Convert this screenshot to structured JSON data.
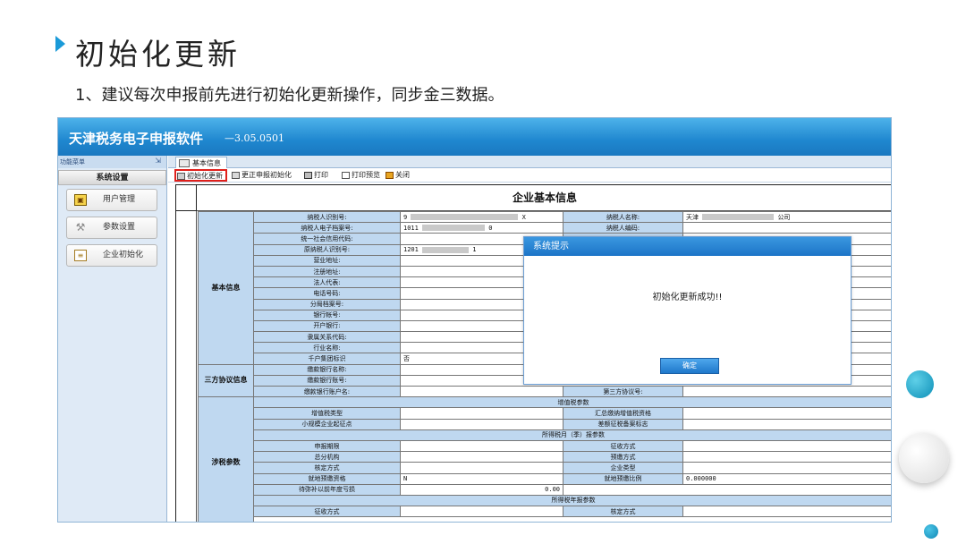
{
  "slide": {
    "heading": "初始化更新",
    "subtitle": "1、建议每次申报前先进行初始化更新操作，同步金三数据。"
  },
  "app": {
    "title": "天津税务电子申报软件",
    "version": "—3.05.0501"
  },
  "sidebar": {
    "header": "功能菜单",
    "pin": "⇲",
    "section": "系统设置",
    "items": [
      {
        "label": "用户管理",
        "icon": "user-icon"
      },
      {
        "label": "参数设置",
        "icon": "wrench-icon"
      },
      {
        "label": "企业初始化",
        "icon": "document-icon"
      }
    ]
  },
  "tab": {
    "label": "基本信息"
  },
  "toolbar": {
    "init": "初始化更新",
    "fix": "更正申报初始化",
    "print": "打印",
    "preview": "打印预览",
    "close": "关闭"
  },
  "form": {
    "title": "企业基本信息",
    "groups": {
      "basic": "基本信息",
      "tripartite": "三方协议信息",
      "tax": "涉税参数"
    },
    "basic_rows": [
      {
        "label": "纳税人识别号:",
        "value": "9",
        "value_tail": "X",
        "label2": "纳税人名称:",
        "value2": "天津",
        "value2_tail": "公司"
      },
      {
        "label": "纳税人电子档案号:",
        "value": "1011",
        "value_tail": "0",
        "label2": "纳税人编码:",
        "value2": ""
      },
      {
        "label": "统一社会信用代码:",
        "value": "",
        "label2": "",
        "value2": ""
      },
      {
        "label": "原纳税人识别号:",
        "value": "1201",
        "value_tail": "1",
        "label2": "",
        "value2": ""
      },
      {
        "label": "营业地址:",
        "value": ""
      },
      {
        "label": "注册地址:",
        "value": ""
      },
      {
        "label": "法人代表:",
        "value": ""
      },
      {
        "label": "电话号码:",
        "value": ""
      },
      {
        "label": "分局档案号:",
        "value": ""
      },
      {
        "label": "银行帐号:",
        "value": ""
      },
      {
        "label": "开户银行:",
        "value": ""
      },
      {
        "label": "隶属关系代码:",
        "value": ""
      },
      {
        "label": "行业名称:",
        "value": ""
      },
      {
        "label": "千户集团标识",
        "value": "否"
      }
    ],
    "tripartite_rows": [
      {
        "label": "缴款银行名称:",
        "value": ""
      },
      {
        "label": "缴款银行账号:",
        "value": ""
      },
      {
        "label": "缴款银行账户名:",
        "value": "",
        "label2": "第三方协议号:",
        "value2": ""
      }
    ],
    "tax_rows": {
      "vat_section": "增值税参数",
      "vat_type": "增值税类型",
      "vat_summary": "汇总缴纳增值税资格",
      "small_scale": "小规模企业起征点",
      "diff_levy": "差额征税备案标志",
      "income_section": "所得税月（季）报参数",
      "declare_period": "申报期限",
      "levy_method": "征收方式",
      "hq_branch": "总分机构",
      "prepay_method": "预缴方式",
      "assess_method": "核定方式",
      "enterprise_type": "企业类型",
      "local_prepay": "就地预缴资格",
      "local_prepay_value": "N",
      "local_prepay_ratio": "就地预缴比例",
      "local_prepay_ratio_value": "0.000000",
      "loss_carryover": "待弥补以前年度亏损",
      "loss_carryover_value": "0.00",
      "annual_section": "所得税年报参数",
      "annual_levy": "征收方式",
      "annual_assess": "核定方式"
    }
  },
  "dialog": {
    "title": "系统提示",
    "message": "初始化更新成功!!",
    "ok": "确定"
  }
}
